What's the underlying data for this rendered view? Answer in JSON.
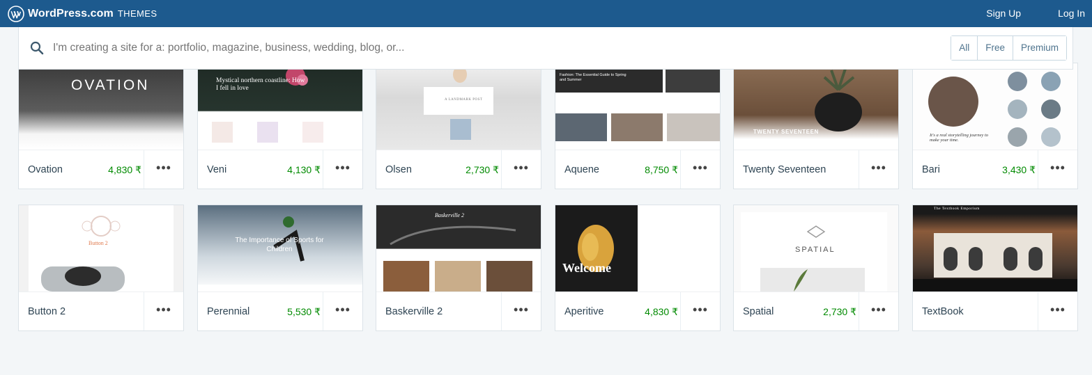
{
  "masterbar": {
    "brand": "WordPress.com",
    "section": "THEMES",
    "signup": "Sign Up",
    "login": "Log In"
  },
  "search": {
    "placeholder": "I'm creating a site for a: portfolio, magazine, business, wedding, blog, or...",
    "filters": [
      "All",
      "Free",
      "Premium"
    ]
  },
  "themes": [
    {
      "name": "Ovation",
      "price": "4,830 ₹",
      "thumb": {
        "title": "OVATION"
      }
    },
    {
      "name": "Veni",
      "price": "4,130 ₹",
      "thumb": {
        "title": "Mystical northern coastline: How I fell in love"
      }
    },
    {
      "name": "Olsen",
      "price": "2,730 ₹",
      "thumb": {
        "title": "A LANDMARK POST"
      }
    },
    {
      "name": "Aquene",
      "price": "8,750 ₹",
      "thumb": {
        "title": "Fashion: The Essential Guide to Spring and Summer"
      }
    },
    {
      "name": "Twenty Seventeen",
      "price": "",
      "thumb": {
        "title": "TWENTY SEVENTEEN"
      }
    },
    {
      "name": "Bari",
      "price": "3,430 ₹",
      "thumb": {
        "title": "It's a real storytelling journey to make your time."
      }
    },
    {
      "name": "Button 2",
      "price": "",
      "thumb": {
        "title": "Button 2"
      }
    },
    {
      "name": "Perennial",
      "price": "5,530 ₹",
      "thumb": {
        "title": "The Importance of Sports for Children"
      }
    },
    {
      "name": "Baskerville 2",
      "price": "",
      "thumb": {
        "title": "Baskerville 2"
      }
    },
    {
      "name": "Aperitive",
      "price": "4,830 ₹",
      "thumb": {
        "title": "Welcome"
      }
    },
    {
      "name": "Spatial",
      "price": "2,730 ₹",
      "thumb": {
        "title": "SPATIAL"
      }
    },
    {
      "name": "TextBook",
      "price": "",
      "thumb": {
        "title": "The Textbook Emporium"
      }
    }
  ],
  "colors": {
    "masterbar": "#1d5a8e",
    "price": "#008a00",
    "background": "#f3f6f8"
  }
}
